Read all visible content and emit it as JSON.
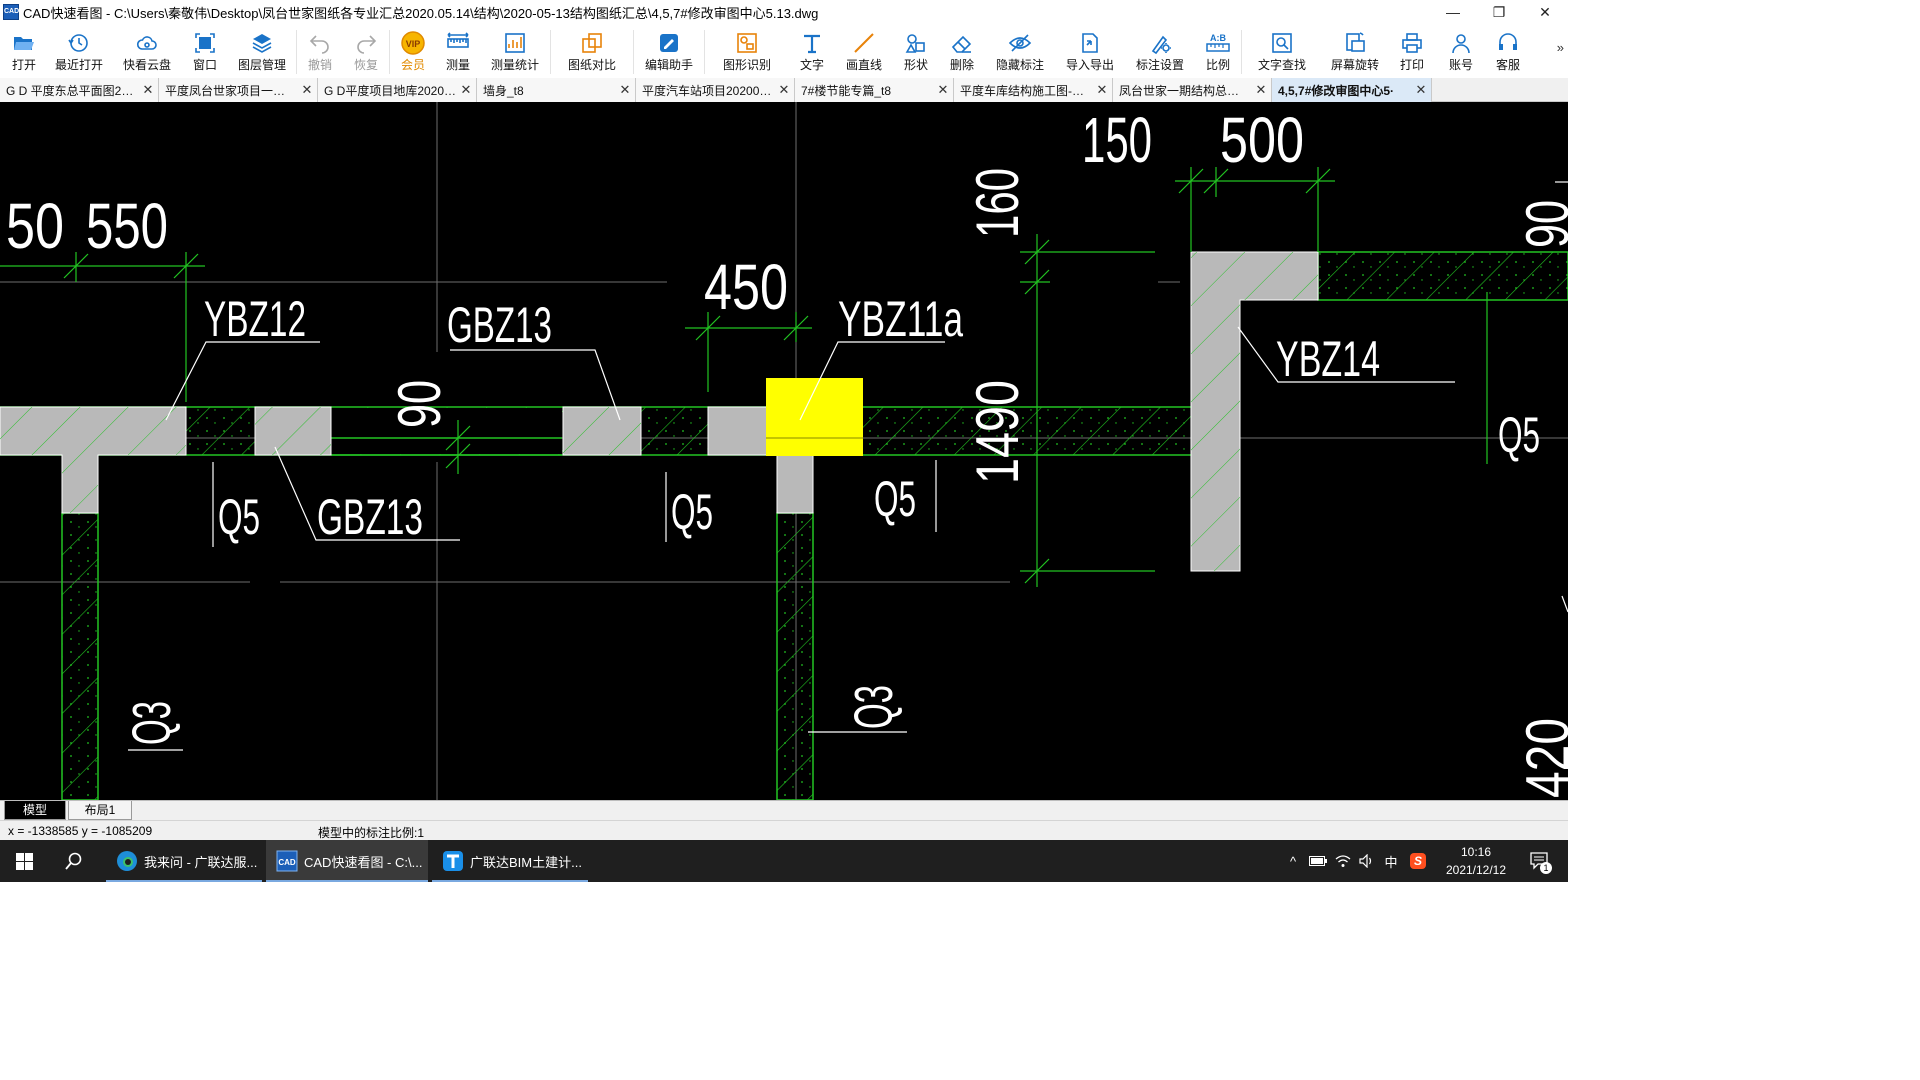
{
  "window": {
    "title": "CAD快速看图 - C:\\Users\\秦敬伟\\Desktop\\凤台世家图纸各专业汇总2020.05.14\\结构\\2020-05-13结构图纸汇总\\4,5,7#修改审图中心5.13.dwg",
    "app_icon_text": "CAD",
    "minimize": "—",
    "restore": "❐",
    "close": "✕"
  },
  "toolbar": {
    "items": [
      {
        "label": "打开",
        "icon": "folder-open-icon"
      },
      {
        "label": "最近打开",
        "icon": "recent-clock-icon"
      },
      {
        "label": "快看云盘",
        "icon": "cloud-icon"
      },
      {
        "label": "窗口",
        "icon": "window-icon"
      },
      {
        "label": "图层管理",
        "icon": "layers-icon"
      },
      {
        "label": "撤销",
        "icon": "undo-icon",
        "disabled": true
      },
      {
        "label": "恢复",
        "icon": "redo-icon",
        "disabled": true
      },
      {
        "label": "会员",
        "icon": "vip-icon",
        "vip": true
      },
      {
        "label": "测量",
        "icon": "ruler-icon"
      },
      {
        "label": "测量统计",
        "icon": "measure-stats-icon"
      },
      {
        "label": "图纸对比",
        "icon": "compare-icon"
      },
      {
        "label": "编辑助手",
        "icon": "edit-assistant-icon"
      },
      {
        "label": "图形识别",
        "icon": "shape-recognition-icon"
      },
      {
        "label": "文字",
        "icon": "text-icon"
      },
      {
        "label": "画直线",
        "icon": "line-icon"
      },
      {
        "label": "形状",
        "icon": "shapes-icon"
      },
      {
        "label": "删除",
        "icon": "eraser-icon"
      },
      {
        "label": "隐藏标注",
        "icon": "hide-eye-icon"
      },
      {
        "label": "导入导出",
        "icon": "import-export-icon"
      },
      {
        "label": "标注设置",
        "icon": "annotation-settings-icon"
      },
      {
        "label": "比例",
        "icon": "scale-icon"
      },
      {
        "label": "文字查找",
        "icon": "text-search-icon"
      },
      {
        "label": "屏幕旋转",
        "icon": "screen-rotate-icon"
      },
      {
        "label": "打印",
        "icon": "printer-icon"
      },
      {
        "label": "账号",
        "icon": "user-icon"
      },
      {
        "label": "客服",
        "icon": "headset-icon"
      }
    ],
    "more": "»"
  },
  "tabs": [
    {
      "label": "G D 平度东总平面图2…",
      "active": false
    },
    {
      "label": "平度凤台世家项目一…",
      "active": false
    },
    {
      "label": "G D平度项目地库2020…",
      "active": false
    },
    {
      "label": "墙身_t8",
      "active": false
    },
    {
      "label": "平度汽车站项目20200…",
      "active": false
    },
    {
      "label": "7#楼节能专篇_t8",
      "active": false
    },
    {
      "label": "平度车库结构施工图-…",
      "active": false
    },
    {
      "label": "凤台世家一期结构总…",
      "active": false
    },
    {
      "label": "4,5,7#修改审图中心5·",
      "active": true
    }
  ],
  "tab_close": "✕",
  "drawing": {
    "labels": {
      "dim_50": "50",
      "dim_550": "550",
      "ybz12": "YBZ12",
      "gbz13_top": "GBZ13",
      "dim_450": "450",
      "ybz11a": "YBZ11a",
      "dim_150": "150",
      "dim_500": "500",
      "dim_160": "160",
      "ybz14": "YBZ14",
      "dim_90_left": "90",
      "dim_1490": "1490",
      "dim_90_right": "90",
      "q5_a": "Q5",
      "gbz13_bottom": "GBZ13",
      "q5_b": "Q5",
      "q5_c": "Q5",
      "q5_d": "Q5",
      "q3_a": "Q3",
      "q3_b": "Q3",
      "dim_420": "420"
    },
    "colors": {
      "background": "#000000",
      "wall_green": "#22c422",
      "column_gray": "#b9b9b9",
      "highlight_yellow": "#ffff00",
      "text_white": "#ffffff",
      "grid_gray": "#6e6e6e"
    }
  },
  "layout_tabs": {
    "model": "模型",
    "layout1": "布局1"
  },
  "status": {
    "coords": "x = -1338585 y = -1085209",
    "scale_text": "模型中的标注比例:1"
  },
  "taskbar": {
    "start_icon": "windows-start-icon",
    "search_icon": "search-icon",
    "apps": [
      {
        "label": "我来问 - 广联达服...",
        "icon": "edge-browser-icon",
        "active": false
      },
      {
        "label": "CAD快速看图 - C:\\...",
        "icon": "cad-viewer-icon",
        "active": true
      },
      {
        "label": "广联达BIM土建计...",
        "icon": "glodon-t-icon",
        "active": false
      }
    ],
    "tray": {
      "chevron": "^",
      "ime": "中",
      "sogou": "S",
      "time": "10:16",
      "date": "2021/12/12",
      "notify_count": "1"
    }
  }
}
